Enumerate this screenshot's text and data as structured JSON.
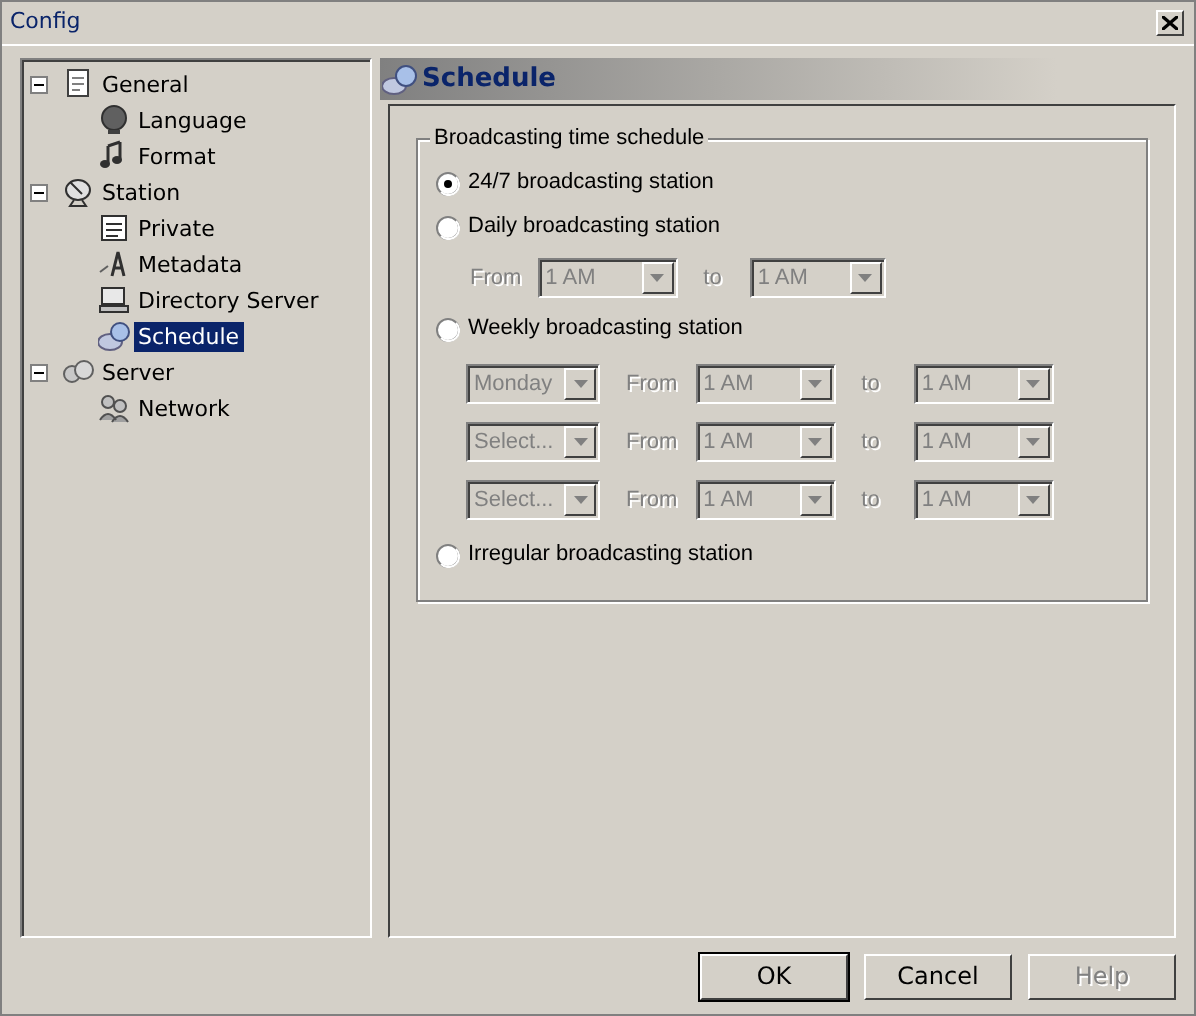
{
  "window": {
    "title": "Config"
  },
  "tree": [
    {
      "label": "General",
      "expanded": true,
      "selected": false,
      "children": [
        {
          "label": "Language",
          "selected": false
        },
        {
          "label": "Format",
          "selected": false
        }
      ]
    },
    {
      "label": "Station",
      "expanded": true,
      "selected": false,
      "children": [
        {
          "label": "Private",
          "selected": false
        },
        {
          "label": "Metadata",
          "selected": false
        },
        {
          "label": "Directory Server",
          "selected": false
        },
        {
          "label": "Schedule",
          "selected": true
        }
      ]
    },
    {
      "label": "Server",
      "expanded": true,
      "selected": false,
      "children": [
        {
          "label": "Network",
          "selected": false
        }
      ]
    }
  ],
  "panel": {
    "title": "Schedule",
    "group": {
      "title": "Broadcasting time schedule",
      "options": [
        {
          "label": "24/7 broadcasting station",
          "selected": true
        },
        {
          "label": "Daily broadcasting station",
          "selected": false,
          "rows": [
            {
              "from_label": "From",
              "from": "1 AM",
              "to_label": "to",
              "to": "1 AM",
              "disabled": true
            }
          ]
        },
        {
          "label": "Weekly broadcasting station",
          "selected": false,
          "rows": [
            {
              "day": "Monday",
              "from_label": "From",
              "from": "1 AM",
              "to_label": "to",
              "to": "1 AM",
              "disabled": true
            },
            {
              "day": "Select...",
              "from_label": "From",
              "from": "1 AM",
              "to_label": "to",
              "to": "1 AM",
              "disabled": true
            },
            {
              "day": "Select...",
              "from_label": "From",
              "from": "1 AM",
              "to_label": "to",
              "to": "1 AM",
              "disabled": true
            }
          ]
        },
        {
          "label": "Irregular broadcasting station",
          "selected": false
        }
      ]
    }
  },
  "buttons": [
    {
      "label": "OK",
      "default": true,
      "disabled": false
    },
    {
      "label": "Cancel",
      "default": false,
      "disabled": false
    },
    {
      "label": "Help",
      "default": false,
      "disabled": true
    }
  ]
}
